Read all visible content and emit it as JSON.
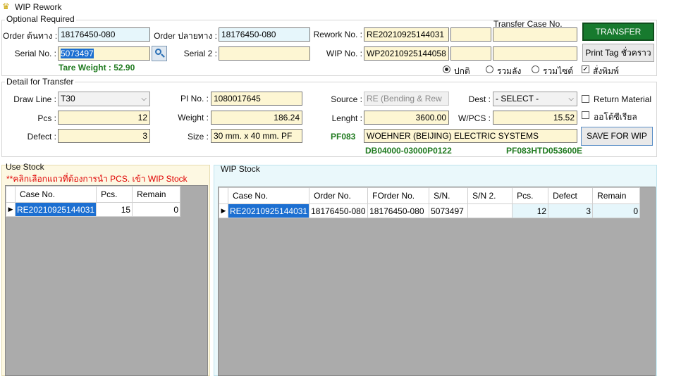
{
  "window": {
    "title": "WIP Rework",
    "icon": "trophy-icon"
  },
  "optional": {
    "title": "Optional Required",
    "order_src_label": "Order ต้นทาง :",
    "order_src_value": "18176450-080",
    "order_dst_label": "Order ปลายทาง :",
    "order_dst_value": "18176450-080",
    "rework_label": "Rework No. :",
    "rework_value": "RE20210925144031",
    "transfer_case_label": "Transfer Case No.",
    "transfer_button": "TRANSFER",
    "serial_label": "Serial No. :",
    "serial_value": "5073497",
    "serial2_label": "Serial 2 :",
    "serial2_value": "",
    "wip_label": "WIP No. :",
    "wip_value": "WP20210925144058",
    "print_button": "Print Tag ชั่วคราว",
    "tare_weight": "Tare Weight : 52.90",
    "radio_normal": "ปกติ",
    "radio_combine_case": "รวมลัง",
    "radio_combine_size": "รวมไซต์",
    "check_print": "สั่งพิมพ์"
  },
  "detail": {
    "title": "Detail for Transfer",
    "drawline_label": "Draw Line :",
    "drawline_value": "T30",
    "pcs_label": "Pcs :",
    "pcs_value": "12",
    "defect_label": "Defect :",
    "defect_value": "3",
    "pi_label": "PI No. :",
    "pi_value": "1080017645",
    "weight_label": "Weight :",
    "weight_value": "186.24",
    "size_label": "Size :",
    "size_value": "30 mm. x 40 mm. PF",
    "source_label": "Source :",
    "source_value": "RE (Bending & Rew",
    "dest_label": "Dest :",
    "dest_value": "- SELECT -",
    "lenght_label": "Lenght :",
    "lenght_value": "3600.00",
    "wpcs_label": "W/PCS :",
    "wpcs_value": "15.52",
    "return_material": "Return Material",
    "auto_serial": "ออโต้ซีเรียล",
    "customer_code": "PF083",
    "customer_name": "WOEHNER (BEIJING) ELECTRIC SYSTEMS",
    "save_button": "SAVE FOR WIP",
    "part_code": "DB04000-03000P0122",
    "part_code2": "PF083HTD053600E"
  },
  "use_stock": {
    "title": "Use Stock",
    "hint": "**คลิกเลือกแถวที่ต้องการนำ PCS. เข้า WIP Stock",
    "columns": [
      "Case No.",
      "Pcs.",
      "Remain"
    ],
    "rows": [
      {
        "case_no": "RE20210925144031",
        "pcs": "15",
        "remain": "0"
      }
    ]
  },
  "wip_stock": {
    "title": "WIP Stock",
    "columns": [
      "Case No.",
      "Order No.",
      "FOrder No.",
      "S/N.",
      "S/N 2.",
      "Pcs.",
      "Defect",
      "Remain"
    ],
    "rows": [
      {
        "case_no": "RE20210925144031",
        "order_no": "18176450-080",
        "forder_no": "18176450-080",
        "sn": "5073497",
        "sn2": "",
        "pcs": "12",
        "defect": "3",
        "remain": "0"
      }
    ]
  },
  "colors": {
    "accent_green": "#177a2e",
    "selection_blue": "#1c6fd1",
    "input_yellow": "#fdf6d3",
    "input_blue": "#e6f6fb"
  }
}
